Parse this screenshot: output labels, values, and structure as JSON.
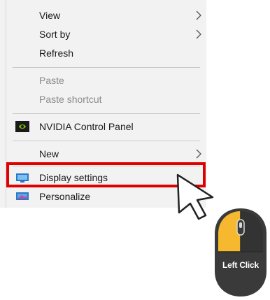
{
  "menu": {
    "items": [
      {
        "label": "View",
        "has_submenu": true,
        "enabled": true
      },
      {
        "label": "Sort by",
        "has_submenu": true,
        "enabled": true
      },
      {
        "label": "Refresh",
        "has_submenu": false,
        "enabled": true
      },
      {
        "label": "Paste",
        "has_submenu": false,
        "enabled": false
      },
      {
        "label": "Paste shortcut",
        "has_submenu": false,
        "enabled": false
      },
      {
        "label": "NVIDIA Control Panel",
        "has_submenu": false,
        "enabled": true,
        "icon": "nvidia-icon"
      },
      {
        "label": "New",
        "has_submenu": true,
        "enabled": true
      },
      {
        "label": "Display settings",
        "has_submenu": false,
        "enabled": true,
        "icon": "display-icon",
        "highlighted": true
      },
      {
        "label": "Personalize",
        "has_submenu": false,
        "enabled": true,
        "icon": "personalize-icon"
      }
    ]
  },
  "mouse": {
    "label": "Left Click",
    "highlighted_button": "left",
    "accent_color": "#f5b82e",
    "body_color": "#3a3a3a"
  },
  "colors": {
    "highlight_border": "#e00000",
    "menu_bg": "#f2f2f2"
  }
}
